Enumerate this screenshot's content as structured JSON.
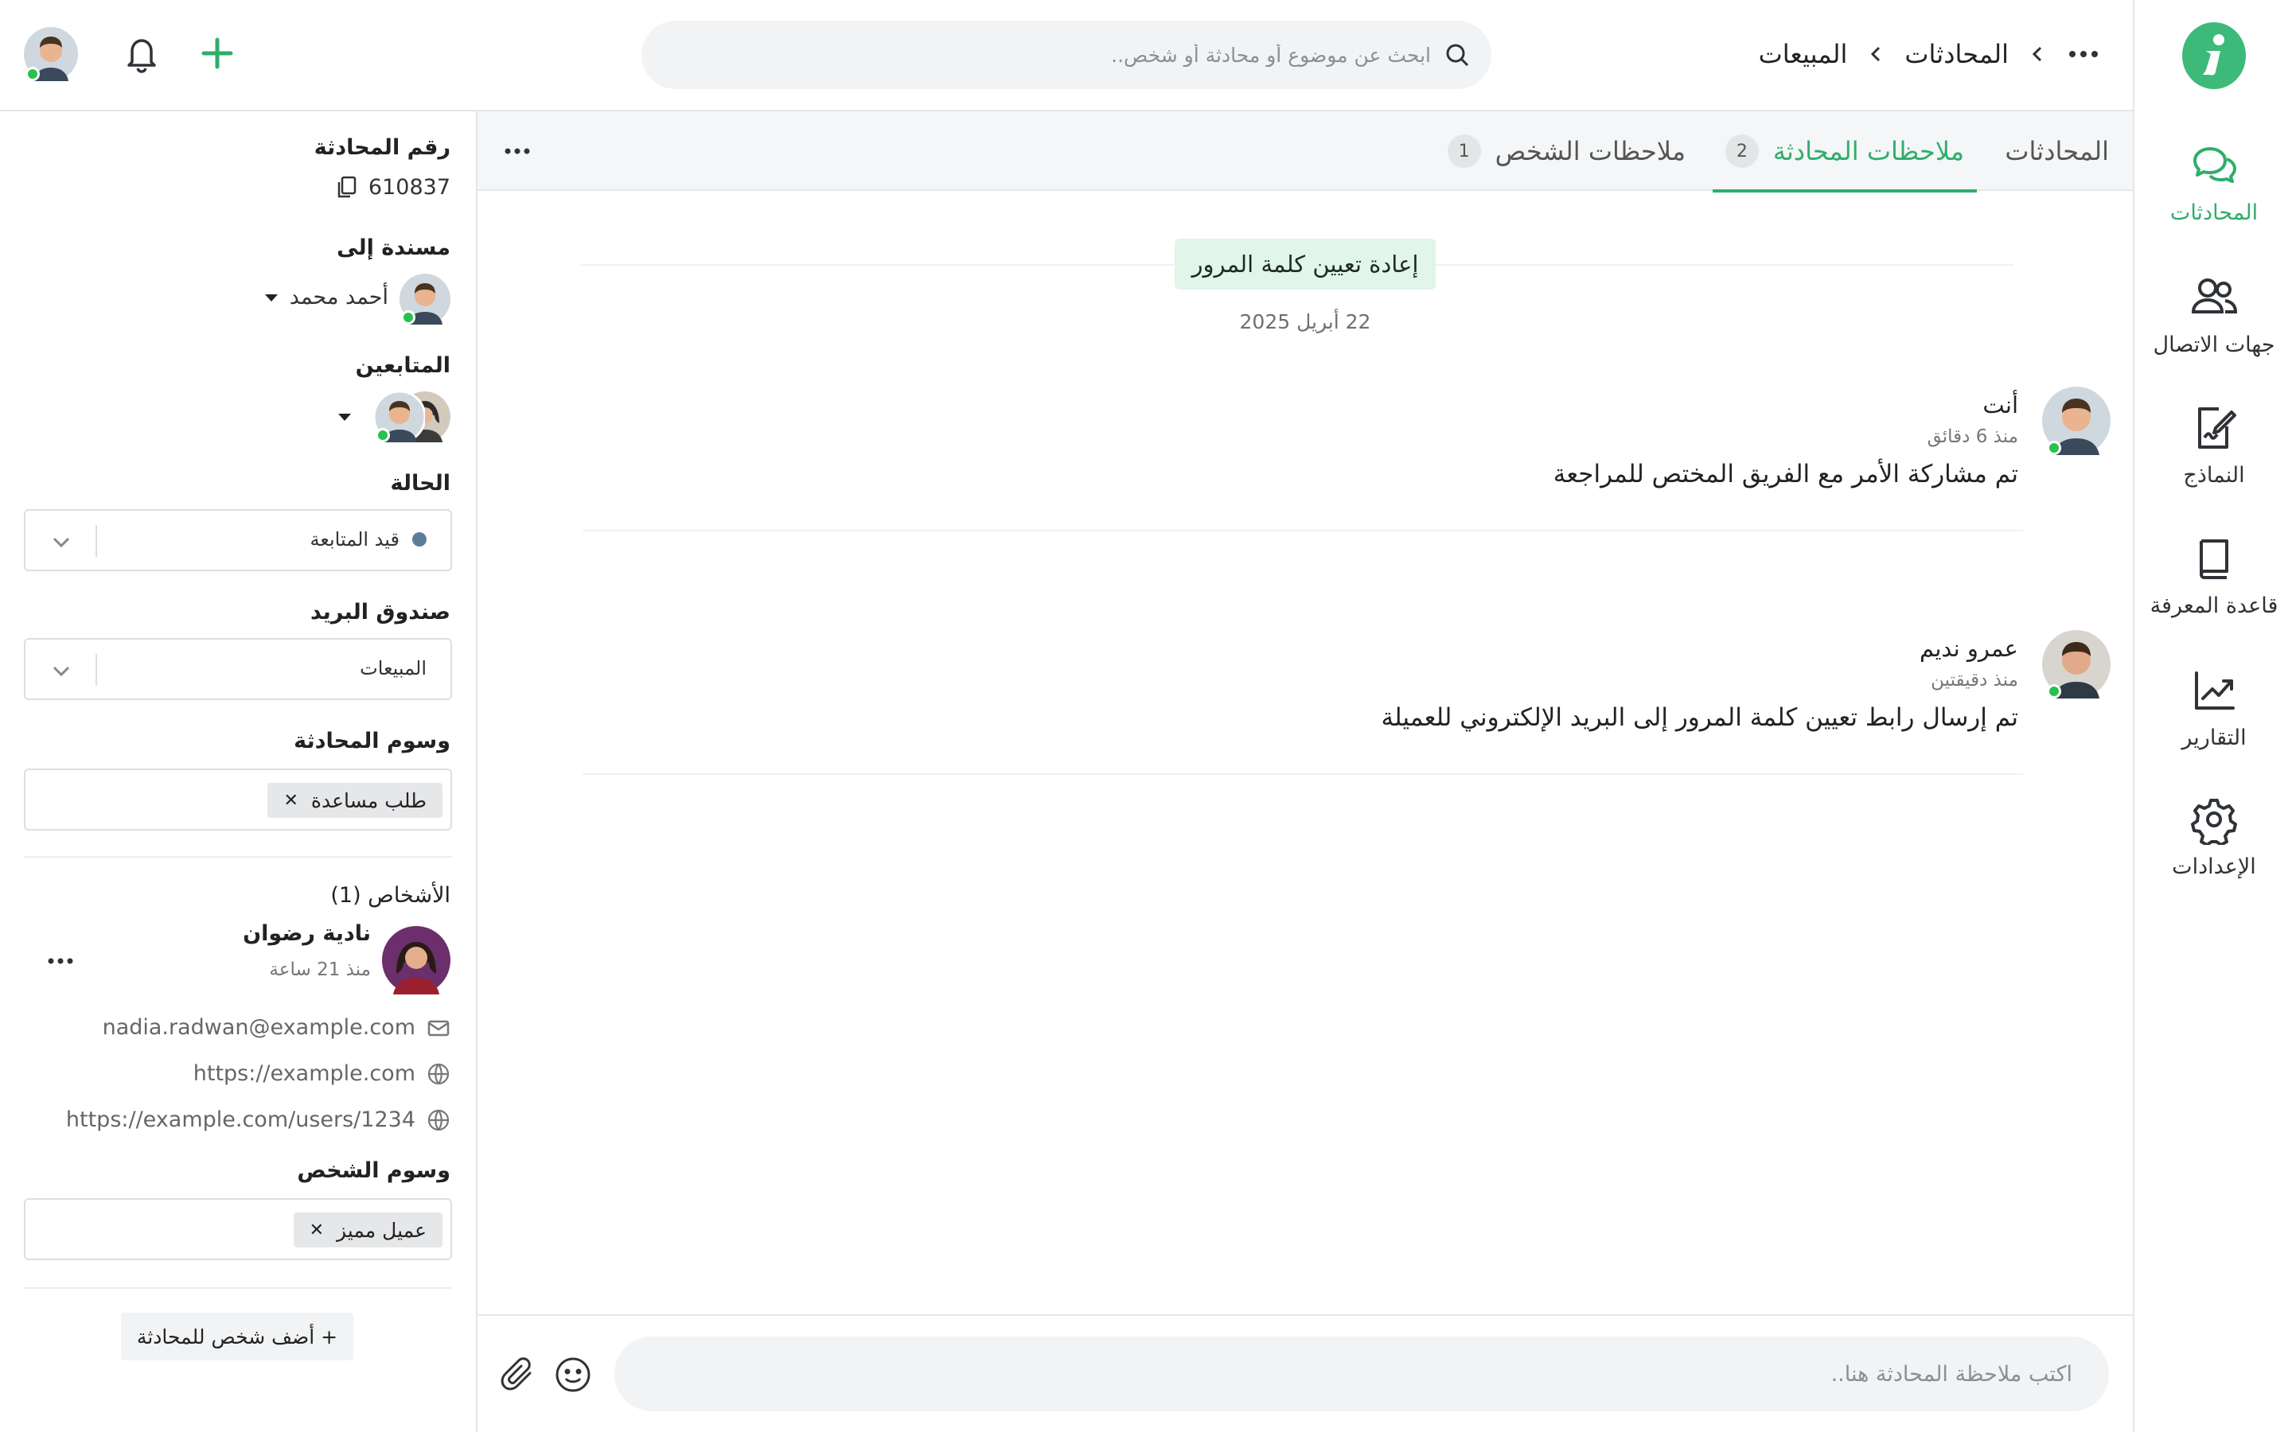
{
  "nav": {
    "items": [
      {
        "label": "المحادثات",
        "icon": "chat-icon",
        "active": true
      },
      {
        "label": "جهات الاتصال",
        "icon": "contacts-icon",
        "active": false
      },
      {
        "label": "النماذج",
        "icon": "forms-icon",
        "active": false
      },
      {
        "label": "قاعدة المعرفة",
        "icon": "book-icon",
        "active": false
      },
      {
        "label": "التقارير",
        "icon": "chart-icon",
        "active": false
      },
      {
        "label": "الإعدادات",
        "icon": "gear-icon",
        "active": false
      }
    ]
  },
  "breadcrumb": {
    "items": [
      "المحادثات",
      "المبيعات"
    ]
  },
  "search": {
    "placeholder": "ابحث عن موضوع أو محادثة أو شخص.."
  },
  "tabs": [
    {
      "label": "المحادثات",
      "count": ""
    },
    {
      "label": "ملاحظات المحادثة",
      "count": "2"
    },
    {
      "label": "ملاحظات الشخص",
      "count": "1"
    }
  ],
  "conversation": {
    "subject": "إعادة تعيين كلمة المرور",
    "date": "22 أبريل 2025",
    "messages": [
      {
        "author": "أنت",
        "time": "منذ 6 دقائق",
        "text": "تم مشاركة الأمر مع الفريق المختص للمراجعة"
      },
      {
        "author": "عمرو نديم",
        "time": "منذ دقيقتين",
        "text": "تم إرسال رابط تعيين كلمة المرور إلى البريد الإلكتروني للعميلة"
      }
    ]
  },
  "composer": {
    "placeholder": "اكتب ملاحظة المحادثة هنا.."
  },
  "details": {
    "conversation_id_label": "رقم المحادثة",
    "conversation_id": "610837",
    "assigned_label": "مسندة إلى",
    "assigned_to": "أحمد محمد",
    "followers_label": "المتابعين",
    "status_label": "الحالة",
    "status_value": "قيد المتابعة",
    "status_color": "#5e7e98",
    "inbox_label": "صندوق البريد",
    "inbox_value": "المبيعات",
    "conv_tags_label": "وسوم المحادثة",
    "conv_tag": "طلب مساعدة",
    "people_label": "الأشخاص (1)",
    "person": {
      "name": "نادية رضوان",
      "time": "منذ 21 ساعة",
      "email": "nadia.radwan@example.com",
      "website": "https://example.com",
      "profile": "https://example.com/users/1234"
    },
    "person_tags_label": "وسوم الشخص",
    "person_tag": "عميل مميز",
    "add_person": "+ أضف شخص للمحادثة"
  },
  "colors": {
    "accent": "#2fae6b",
    "logo": "#3dba79",
    "online": "#27c24c"
  }
}
